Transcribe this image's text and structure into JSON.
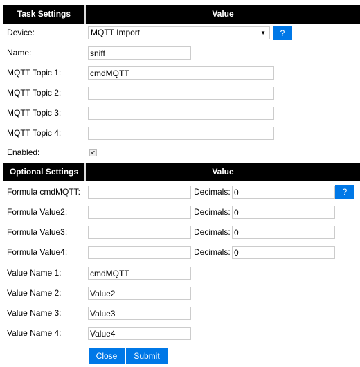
{
  "task_header": {
    "col1": "Task Settings",
    "col2": "Value"
  },
  "device": {
    "label": "Device:",
    "value": "MQTT Import",
    "help": "?"
  },
  "name": {
    "label": "Name:",
    "value": "sniff"
  },
  "topics": [
    {
      "label": "MQTT Topic 1:",
      "value": "cmdMQTT"
    },
    {
      "label": "MQTT Topic 2:",
      "value": ""
    },
    {
      "label": "MQTT Topic 3:",
      "value": ""
    },
    {
      "label": "MQTT Topic 4:",
      "value": ""
    }
  ],
  "enabled": {
    "label": "Enabled:",
    "checked": true,
    "glyph": "✔"
  },
  "optional_header": {
    "col1": "Optional Settings",
    "col2": "Value"
  },
  "formulas": [
    {
      "label": "Formula cmdMQTT:",
      "value": "",
      "decimals_label": "Decimals:",
      "decimals": "0"
    },
    {
      "label": "Formula Value2:",
      "value": "",
      "decimals_label": "Decimals:",
      "decimals": "0"
    },
    {
      "label": "Formula Value3:",
      "value": "",
      "decimals_label": "Decimals:",
      "decimals": "0"
    },
    {
      "label": "Formula Value4:",
      "value": "",
      "decimals_label": "Decimals:",
      "decimals": "0"
    }
  ],
  "formula_help": "?",
  "value_names": [
    {
      "label": "Value Name 1:",
      "value": "cmdMQTT"
    },
    {
      "label": "Value Name 2:",
      "value": "Value2"
    },
    {
      "label": "Value Name 3:",
      "value": "Value3"
    },
    {
      "label": "Value Name 4:",
      "value": "Value4"
    }
  ],
  "buttons": {
    "close": "Close",
    "submit": "Submit"
  },
  "colors": {
    "accent": "#0078e7",
    "header_bg": "#000000"
  }
}
